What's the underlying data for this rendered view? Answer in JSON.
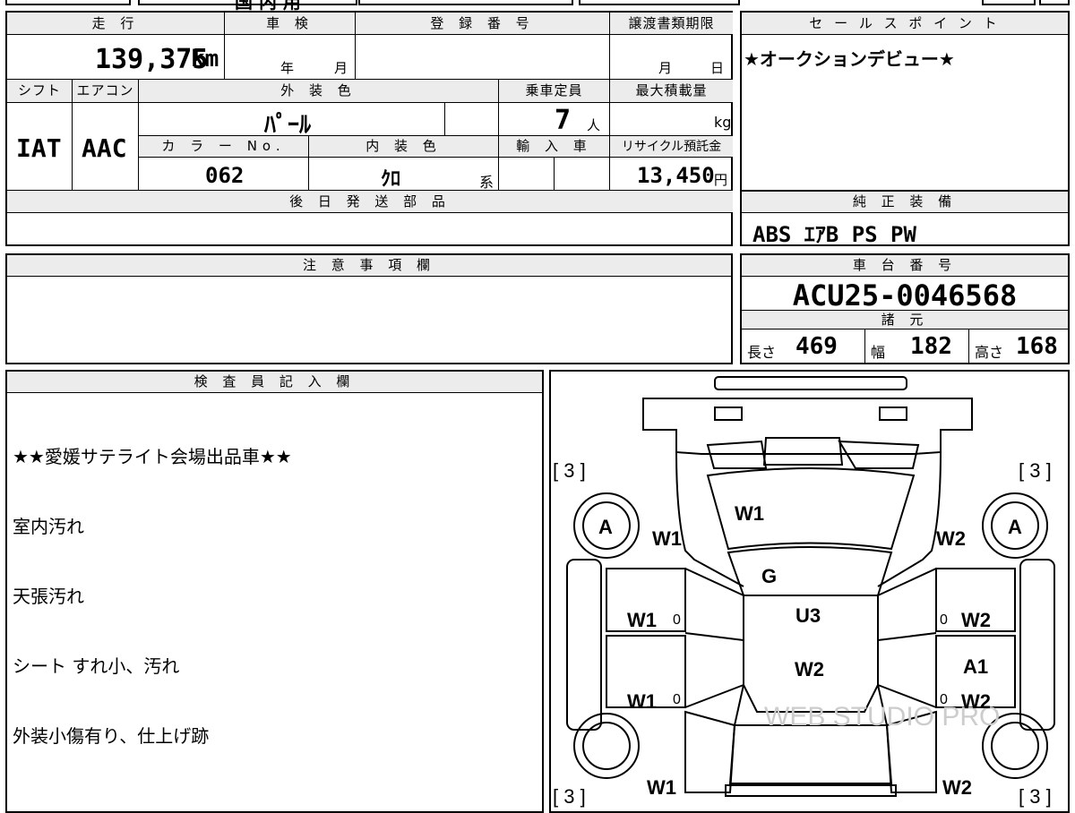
{
  "top_cut": {
    "text": "国 内 用"
  },
  "mileage": {
    "label": "走 行",
    "value": "139,375",
    "unit": "km"
  },
  "inspection": {
    "label": "車 検",
    "year": "年",
    "month": "月"
  },
  "registration": {
    "label": "登 録 番 号",
    "value": ""
  },
  "transfer": {
    "label": "譲渡書類期限",
    "month": "月",
    "day": "日"
  },
  "sales_point": {
    "label": "セ ー ル ス ポ イ ン ト",
    "text": "★オークションデビュー★"
  },
  "shift": {
    "label": "シフト",
    "value": "IAT"
  },
  "aircon": {
    "label": "エアコン",
    "value": "AAC"
  },
  "exterior_color": {
    "label": "外 装 色",
    "value": "ﾊﾟｰﾙ"
  },
  "capacity": {
    "label": "乗車定員",
    "value": "7",
    "unit": "人"
  },
  "max_load": {
    "label": "最大積載量",
    "unit": "kg"
  },
  "color_no": {
    "label": "カ ラ ー No.",
    "value": "062"
  },
  "interior_color": {
    "label": "内 装 色",
    "value": "ｸﾛ",
    "suffix": "系"
  },
  "import": {
    "label": "輸 入 車"
  },
  "recycle": {
    "label": "リサイクル預託金",
    "value": "13,450",
    "unit": "円"
  },
  "later_parts": {
    "label": "後 日 発 送 部 品",
    "value": ""
  },
  "genuine_equipment": {
    "label": "純 正 装 備",
    "value": "ABS ｴｱB PS PW"
  },
  "notes": {
    "label": "注 意 事 項 欄",
    "value": ""
  },
  "chassis": {
    "label": "車 台 番 号",
    "value": "ACU25-0046568"
  },
  "specs": {
    "label": "諸 元",
    "length_label": "長さ",
    "length": "469",
    "width_label": "幅",
    "width": "182",
    "height_label": "高さ",
    "height": "168"
  },
  "inspector": {
    "label": "検 査 員 記 入 欄",
    "lines": [
      "★★愛媛サテライト会場出品車★★",
      "室内汚れ",
      "天張汚れ",
      "シート すれ小、汚れ",
      "外装小傷有り、仕上げ跡"
    ]
  },
  "diagram": {
    "tire_front_left": "[ 3 ]",
    "tire_front_right": "[ 3 ]",
    "tire_rear_left": "[ 3 ]",
    "tire_rear_right": "[ 3 ]",
    "wheel_fl": "A",
    "wheel_fr": "A",
    "hood": "W1",
    "front_left_fender": "W1",
    "front_right_fender": "W2",
    "windshield": "G",
    "roof": "U3",
    "roof_rear": "W2",
    "front_left_door": "W1",
    "front_left_door_zero": "0",
    "rear_left_door": "W1",
    "rear_left_door_zero": "0",
    "front_right_door": "W2",
    "front_right_door_zero": "0",
    "rear_right_door_a": "A1",
    "rear_right_door": "W2",
    "rear_right_door_zero": "0",
    "rear_left_quarter": "W1",
    "rear_right_quarter": "W2",
    "watermark": "WEB STUDIO PRO"
  }
}
